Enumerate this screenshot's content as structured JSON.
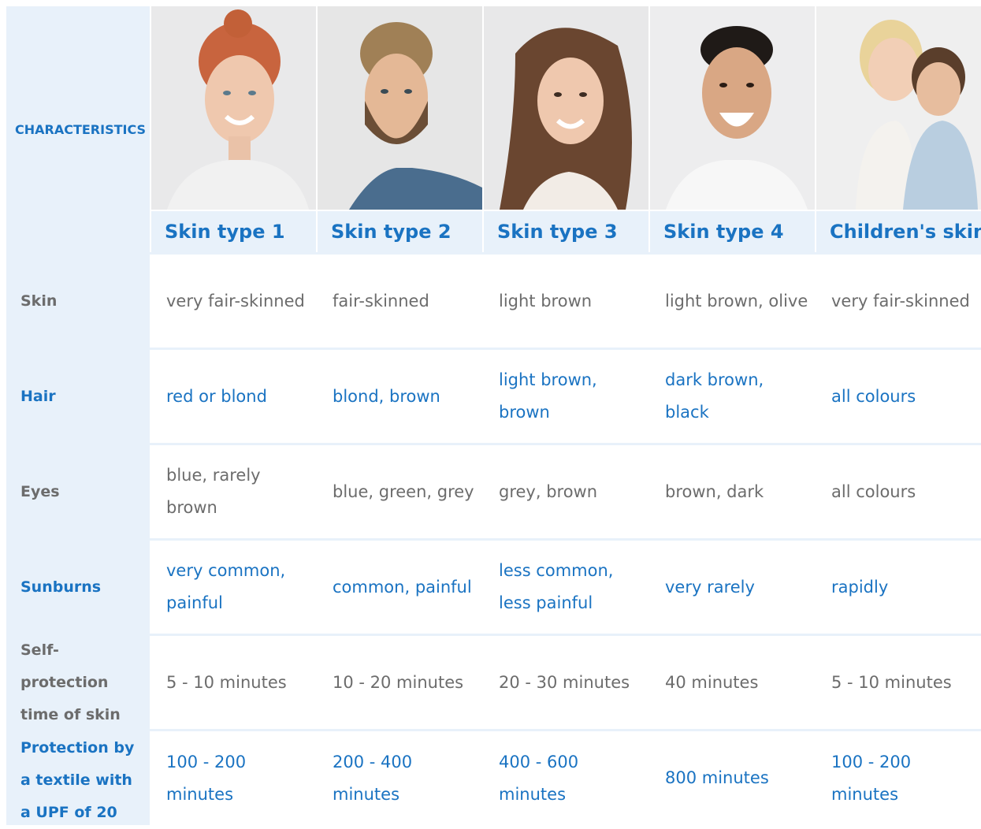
{
  "header": {
    "characteristics_label": "CHARACTERISTICS",
    "columns": [
      {
        "label": "Skin type 1",
        "photo_icon": "woman-red-hair-photo"
      },
      {
        "label": "Skin type 2",
        "photo_icon": "man-blond-beard-photo"
      },
      {
        "label": "Skin type 3",
        "photo_icon": "woman-brown-hair-photo"
      },
      {
        "label": "Skin type 4",
        "photo_icon": "man-dark-hair-photo"
      },
      {
        "label": "Children's skin",
        "photo_icon": "two-children-photo"
      }
    ]
  },
  "rows": [
    {
      "label": "Skin",
      "highlight": false,
      "values": [
        "very fair-skinned",
        "fair-skinned",
        "light brown",
        "light brown, olive",
        "very fair-skinned"
      ]
    },
    {
      "label": "Hair",
      "highlight": true,
      "values": [
        "red or blond",
        "blond, brown",
        "light brown, brown",
        "dark brown, black",
        "all colours"
      ]
    },
    {
      "label": "Eyes",
      "highlight": false,
      "values": [
        "blue, rarely brown",
        "blue, green, grey",
        "grey, brown",
        "brown, dark",
        "all colours"
      ]
    },
    {
      "label": "Sunburns",
      "highlight": true,
      "values": [
        "very common, painful",
        "common, painful",
        "less common, less painful",
        "very rarely",
        "rapidly"
      ]
    },
    {
      "label": "Self-protection time of skin",
      "highlight": false,
      "values": [
        "5 - 10 minutes",
        "10 - 20 minutes",
        "20 - 30 minutes",
        "40 minutes",
        "5 - 10 minutes"
      ]
    },
    {
      "label": "Protection by a textile with a UPF of 20",
      "highlight": true,
      "values": [
        "100 - 200 minutes",
        "200 - 400 minutes",
        "400 - 600 minutes",
        "800 minutes",
        "100 - 200 minutes"
      ]
    }
  ],
  "colors": {
    "accent_blue": "#1a73c2",
    "header_bg": "#e8f1fa",
    "text_grey": "#6c6c6c"
  }
}
